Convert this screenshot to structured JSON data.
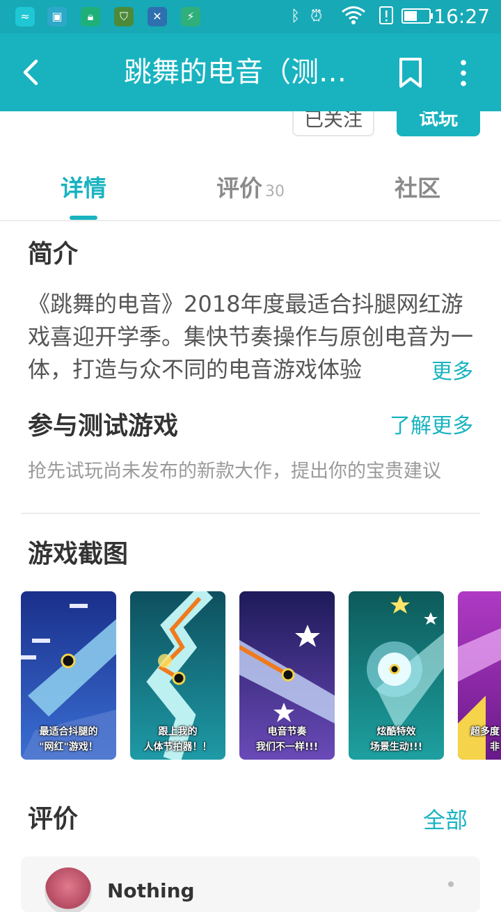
{
  "status_bar": {
    "time": "16:27",
    "left_icons": [
      "wifi-app-icon",
      "gallery-icon",
      "lock-app-icon",
      "shield-icon",
      "tool-icon",
      "security-icon"
    ],
    "right_icons": [
      "bluetooth-icon",
      "alarm-icon",
      "wifi-icon",
      "alert-icon",
      "battery-icon"
    ]
  },
  "app_bar": {
    "title": "跳舞的电音（测试服）"
  },
  "header_buttons": {
    "follow_label": "已关注",
    "play_label": "试玩"
  },
  "tabs": [
    {
      "label": "详情",
      "active": true
    },
    {
      "label": "评价",
      "count": "30"
    },
    {
      "label": "社区"
    }
  ],
  "intro": {
    "title": "简介",
    "text": "《跳舞的电音》2018年度最适合抖腿网红游戏喜迎开学季。集快节奏操作与原创电音为一体，打造与众不同的电音游戏体验",
    "more_label": "更多"
  },
  "test": {
    "title": "参与测试游戏",
    "learn_more": "了解更多",
    "desc": "抢先试玩尚未发布的新款大作，提出你的宝贵建议"
  },
  "screenshots": {
    "title": "游戏截图",
    "items": [
      {
        "caption_1": "最适合抖腿的",
        "caption_2": "\"网红\"游戏！"
      },
      {
        "caption_1": "跟上我的",
        "caption_2": "人体节拍器！！"
      },
      {
        "caption_1": "电音节奏",
        "caption_2": "我们不一样!!!"
      },
      {
        "caption_1": "炫酷特效",
        "caption_2": "场景生动!!!"
      },
      {
        "caption_1": "超多度",
        "caption_2": "非"
      }
    ]
  },
  "reviews": {
    "title": "评价",
    "all_label": "全部",
    "first_user": "Nothing"
  },
  "colors": {
    "accent": "#19b3c0",
    "status_bar": "#17a9b6"
  }
}
